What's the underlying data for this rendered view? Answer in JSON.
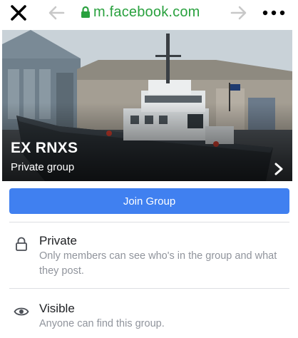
{
  "browser": {
    "url_domain": "m.facebook.com",
    "url_color": "#29a13e",
    "icons": [
      "close-icon",
      "back-arrow-icon",
      "lock-icon",
      "forward-arrow-icon",
      "more-dots-icon"
    ]
  },
  "cover": {
    "group_name": "EX RNXS",
    "group_type": "Private group"
  },
  "join_button": {
    "label": "Join Group",
    "color": "#4080f0"
  },
  "info": [
    {
      "icon": "lock-icon",
      "title": "Private",
      "description": "Only members can see who's in the group and what they post."
    },
    {
      "icon": "eye-icon",
      "title": "Visible",
      "description": "Anyone can find this group."
    }
  ]
}
